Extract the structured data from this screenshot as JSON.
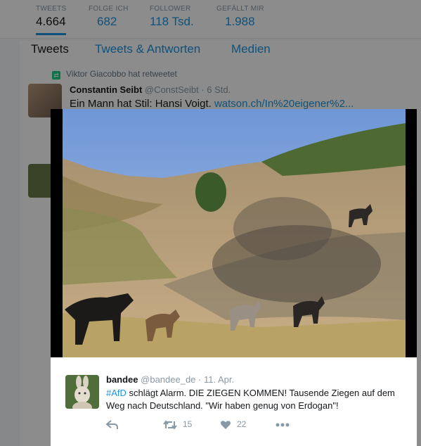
{
  "profile_nav": {
    "stats": [
      {
        "label": "TWEETS",
        "value": "4.664"
      },
      {
        "label": "FOLGE ICH",
        "value": "682"
      },
      {
        "label": "FOLLOWER",
        "value": "118 Tsd."
      },
      {
        "label": "GEFÄLLT MIR",
        "value": "1.988"
      }
    ],
    "tabs": [
      "Tweets",
      "Tweets & Antworten",
      "Medien"
    ]
  },
  "background_tweet": {
    "retweeted_by": "Viktor Giacobbo hat retweetet",
    "name": "Constantin Seibt",
    "handle": "@ConstSeibt",
    "time": "· 6 Std.",
    "text": "Ein Mann hat Stil: Hansi Voigt.",
    "link": "watson.ch/In%20eigener%2..."
  },
  "modal_tweet": {
    "name": "bandee",
    "handle": "@bandee_de",
    "time": "· 11. Apr.",
    "hashtag": "#AfD",
    "text": " schlägt Alarm. DIE ZIEGEN KOMMEN! Tausende Ziegen auf dem Weg nach Deutschland. \"Wir haben genug von Erdogan\"!",
    "retweets": "15",
    "likes": "22",
    "icons": [
      "reply-icon",
      "retweet-icon",
      "heart-icon",
      "more-icon"
    ]
  }
}
